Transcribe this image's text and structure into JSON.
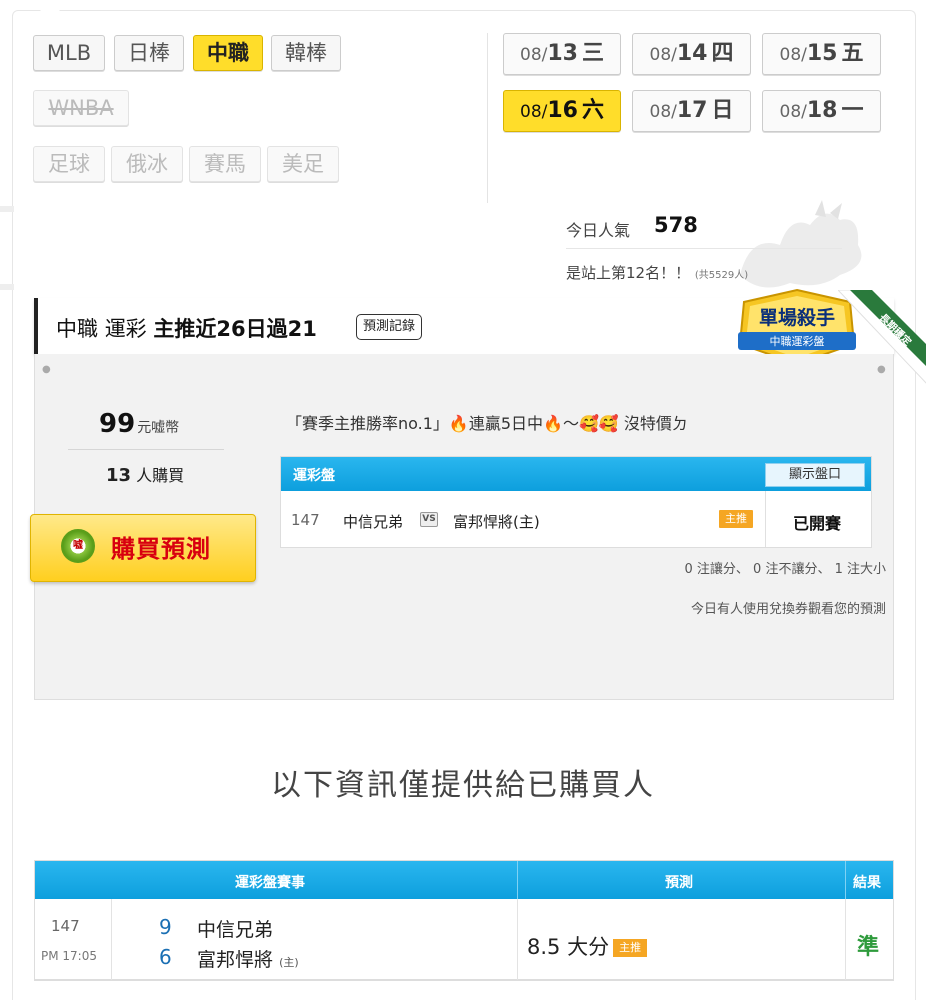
{
  "sports": {
    "row1": [
      {
        "label": "MLB",
        "state": "normal"
      },
      {
        "label": "日棒",
        "state": "normal"
      },
      {
        "label": "中職",
        "state": "active"
      },
      {
        "label": "韓棒",
        "state": "normal"
      }
    ],
    "row2": [
      {
        "label": "WNBA",
        "state": "disabled"
      }
    ],
    "row3": [
      {
        "label": "足球",
        "state": "disabled"
      },
      {
        "label": "俄冰",
        "state": "disabled"
      },
      {
        "label": "賽馬",
        "state": "disabled"
      },
      {
        "label": "美足",
        "state": "disabled"
      }
    ]
  },
  "dates": [
    {
      "month": "08/",
      "day": "13",
      "weekday": "三",
      "active": false
    },
    {
      "month": "08/",
      "day": "14",
      "weekday": "四",
      "active": false
    },
    {
      "month": "08/",
      "day": "15",
      "weekday": "五",
      "active": false
    },
    {
      "month": "08/",
      "day": "16",
      "weekday": "六",
      "active": true
    },
    {
      "month": "08/",
      "day": "17",
      "weekday": "日",
      "active": false
    },
    {
      "month": "08/",
      "day": "18",
      "weekday": "一",
      "active": false
    }
  ],
  "popularity": {
    "label": "今日人氣",
    "value": "578",
    "rank_text": "是站上第12名！！",
    "rank_total": "(共5529人)"
  },
  "panel": {
    "league": "中職",
    "type": "運彩",
    "streak": "主推近26日過21",
    "record_button": "預測記錄",
    "badge_title": "單場殺手",
    "badge_sub": "中職運彩盤",
    "ribbon": "長期穩定"
  },
  "purchase": {
    "price": "99",
    "price_unit": "元嘘幣",
    "buyers_count": "13",
    "buyers_unit": "人購買",
    "buy_button": "購買預測",
    "buy_icon_text": "嘘"
  },
  "slogan": {
    "part1": "「賽季主推勝率no.1」",
    "part2": "連贏5日中",
    "part3": "〜",
    "part4": "沒特價ㄉ"
  },
  "lottery": {
    "header": "運彩盤",
    "show_odds": "顯示盤口",
    "game_no": "147",
    "home": "中信兄弟",
    "vs": "VS",
    "away": "富邦悍將(主)",
    "tag": "主推",
    "status": "已開賽"
  },
  "bet_stats": "0 注讓分、 0 注不讓分、 1 注大小",
  "voucher_note": "今日有人使用兌換券觀看您的預測",
  "notice": "以下資訊僅提供給已購買人",
  "result_table": {
    "headers": {
      "event": "運彩盤賽事",
      "prediction": "預測",
      "result": "結果"
    },
    "game_no": "147",
    "time": "PM 17:05",
    "team1_score": "9",
    "team1_name": "中信兄弟",
    "team2_score": "6",
    "team2_name": "富邦悍將",
    "team2_host": "(主)",
    "prediction": "8.5 大分",
    "prediction_tag": "主推",
    "result": "準"
  },
  "colors": {
    "accent_yellow": "#ffdd2a",
    "header_blue": "#0d9fdd",
    "tag_orange": "#f5a623",
    "win_green": "#2e9b3c"
  }
}
